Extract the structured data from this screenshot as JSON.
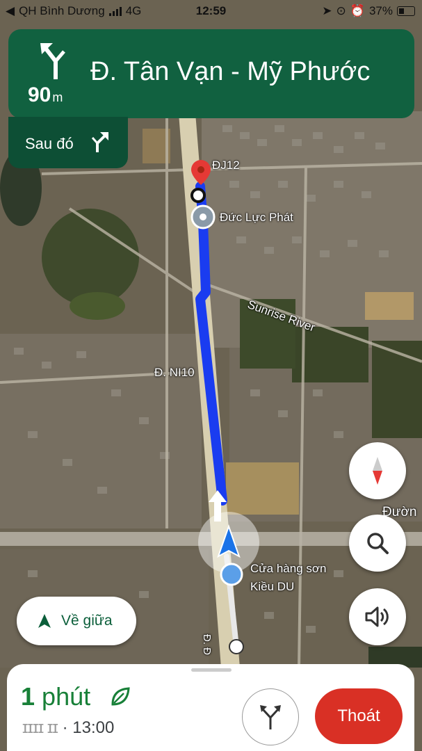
{
  "status": {
    "back_label": "◀",
    "carrier": "QH Bình Dương",
    "network": "4G",
    "time": "12:59",
    "battery": "37%"
  },
  "navigation": {
    "turn_distance_value": "90",
    "turn_distance_unit": "m",
    "street": "Đ. Tân Vạn - Mỹ Phước",
    "then_label": "Sau đó",
    "banner_color": "#116140"
  },
  "map": {
    "labels": {
      "road_top": "ĐJ12",
      "place_1": "Đức Lực Phát",
      "river": "Sunrise River",
      "road_left": "Đ. NI10",
      "road_right": "Đườn",
      "store_line1": "Cửa hàng sơn",
      "store_line2": "Kiều DU",
      "road_bottom": "Đ. Đ"
    },
    "route_color": "#1a3cf0"
  },
  "controls": {
    "recenter_label": "Về giữa"
  },
  "trip": {
    "eta_value": "1",
    "eta_unit": "phút",
    "distance_blur": "ɪɪɪɪ ɪɪ",
    "arrival_time": "· 13:00",
    "exit_label": "Thoát",
    "eta_color": "#188038",
    "exit_color": "#d93025"
  }
}
